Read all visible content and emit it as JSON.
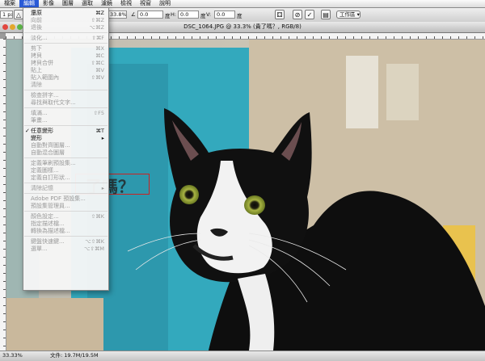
{
  "menubar": {
    "items": [
      "檔案",
      "編輯",
      "影像",
      "圖層",
      "選取",
      "濾鏡",
      "檢視",
      "視窗",
      "說明"
    ],
    "active_index": 1
  },
  "options": {
    "size_value": "1 px",
    "zoom": "33.8%",
    "x_value": "0.0",
    "y_value": "0.0",
    "h_label": "H:",
    "h_value": "0.0",
    "v_label": "V:",
    "v_value": "0.0",
    "unit": "度",
    "workspace": "工作區"
  },
  "document": {
    "title": "DSC_1064.JPG @ 33.3% (貴了嗎？, RGB/8)",
    "layer_text": "了嗎？"
  },
  "status": {
    "zoom": "33.33%",
    "doc_size": "文件: 19.7M/19.5M"
  },
  "edit_menu": [
    {
      "label": "還原",
      "shortcut": "⌘Z",
      "disabled": false
    },
    {
      "label": "向前",
      "shortcut": "⇧⌘Z",
      "disabled": true
    },
    {
      "label": "退後",
      "shortcut": "⌥⌘Z",
      "disabled": true
    },
    {
      "sep": true
    },
    {
      "label": "淡化...",
      "shortcut": "⇧⌘F",
      "disabled": true
    },
    {
      "sep": true
    },
    {
      "label": "剪下",
      "shortcut": "⌘X",
      "disabled": true
    },
    {
      "label": "拷貝",
      "shortcut": "⌘C",
      "disabled": true
    },
    {
      "label": "拷貝合併",
      "shortcut": "⇧⌘C",
      "disabled": true
    },
    {
      "label": "貼上",
      "shortcut": "⌘V",
      "disabled": true
    },
    {
      "label": "貼入範圍內",
      "shortcut": "⇧⌘V",
      "disabled": true
    },
    {
      "label": "清除",
      "shortcut": "",
      "disabled": true
    },
    {
      "sep": true
    },
    {
      "label": "檢查拼字...",
      "shortcut": "",
      "disabled": true
    },
    {
      "label": "尋找與取代文字...",
      "shortcut": "",
      "disabled": true
    },
    {
      "sep": true
    },
    {
      "label": "填滿...",
      "shortcut": "⇧F5",
      "disabled": true
    },
    {
      "label": "筆畫...",
      "shortcut": "",
      "disabled": true
    },
    {
      "sep": true
    },
    {
      "label": "任意變形",
      "shortcut": "⌘T",
      "disabled": false,
      "checked": true
    },
    {
      "label": "變形",
      "shortcut": "▸",
      "disabled": false
    },
    {
      "label": "自動對齊圖層...",
      "shortcut": "",
      "disabled": true
    },
    {
      "label": "自動混合圖層",
      "shortcut": "",
      "disabled": true
    },
    {
      "sep": true
    },
    {
      "label": "定義筆刷預設集...",
      "shortcut": "",
      "disabled": true
    },
    {
      "label": "定義圖樣...",
      "shortcut": "",
      "disabled": true
    },
    {
      "label": "定義自訂形狀...",
      "shortcut": "",
      "disabled": true
    },
    {
      "sep": true
    },
    {
      "label": "清除記憶",
      "shortcut": "▸",
      "disabled": true
    },
    {
      "sep": true
    },
    {
      "label": "Adobe PDF 預設集...",
      "shortcut": "",
      "disabled": true
    },
    {
      "label": "預設集管理員...",
      "shortcut": "",
      "disabled": true
    },
    {
      "sep": true
    },
    {
      "label": "顏色設定...",
      "shortcut": "⇧⌘K",
      "disabled": true
    },
    {
      "label": "指定描述檔...",
      "shortcut": "",
      "disabled": true
    },
    {
      "label": "轉換為描述檔...",
      "shortcut": "",
      "disabled": true
    },
    {
      "sep": true
    },
    {
      "label": "鍵盤快速鍵...",
      "shortcut": "⌥⇧⌘K",
      "disabled": true
    },
    {
      "label": "選單...",
      "shortcut": "⌥⇧⌘M",
      "disabled": true
    }
  ]
}
